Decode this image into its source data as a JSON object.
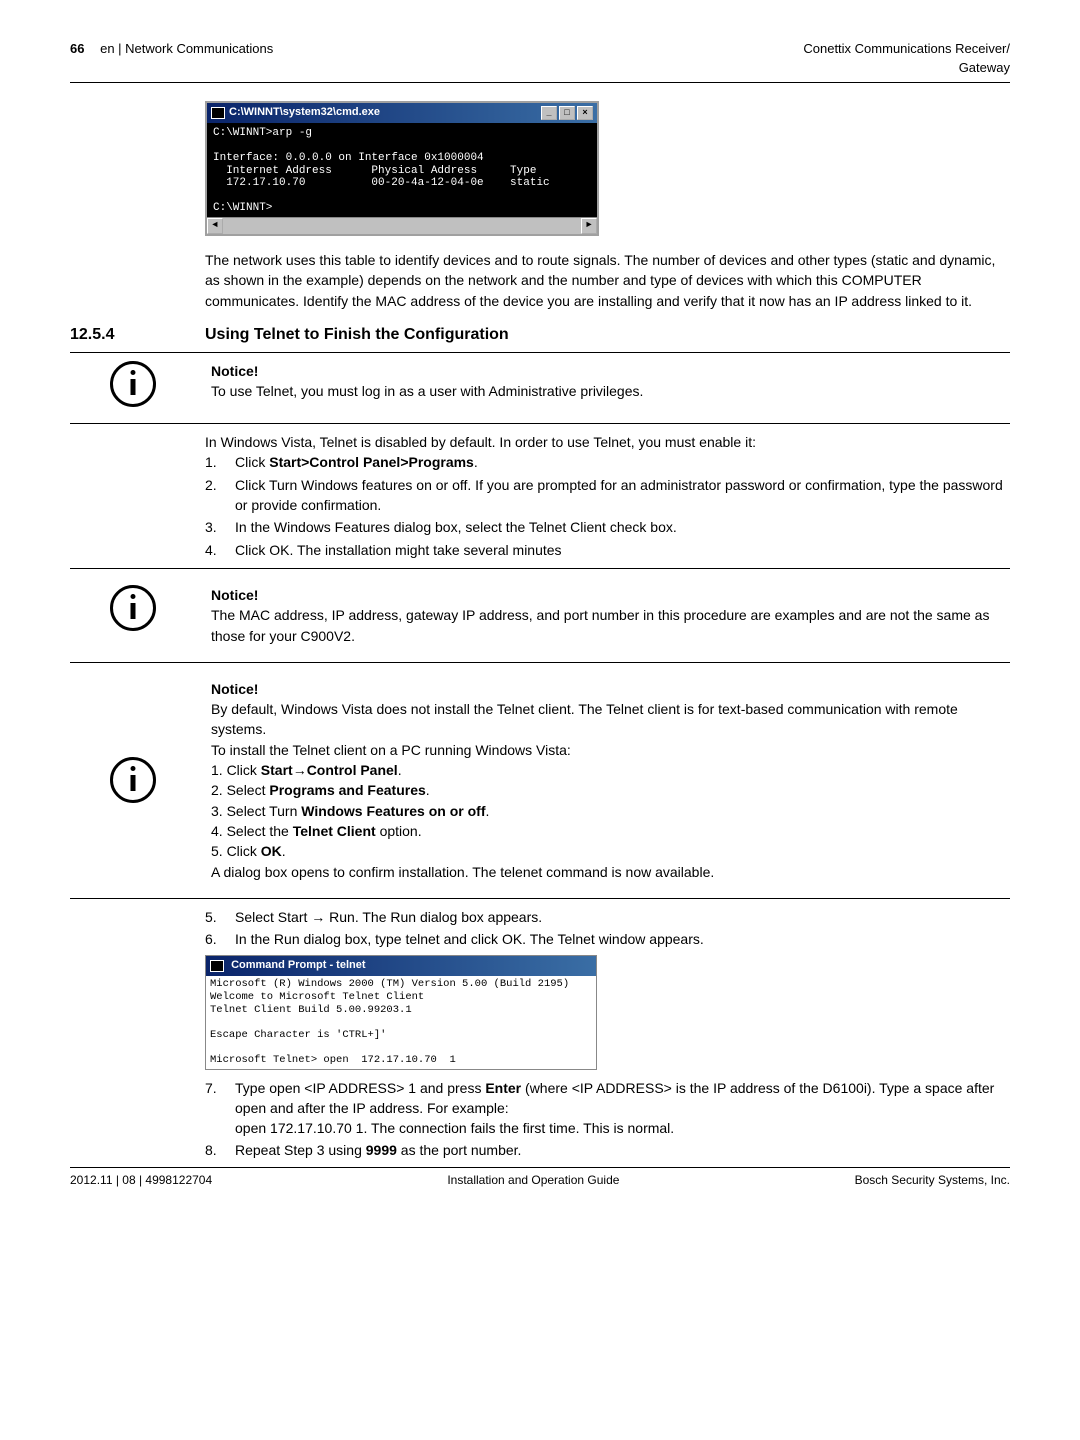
{
  "header": {
    "page_number": "66",
    "breadcrumb": "en | Network Communications",
    "product_line1": "Conettix Communications Receiver/",
    "product_line2": "Gateway"
  },
  "cmd_window": {
    "title": "C:\\WINNT\\system32\\cmd.exe",
    "lines": "C:\\WINNT>arp -g\n\nInterface: 0.0.0.0 on Interface 0x1000004\n  Internet Address      Physical Address     Type\n  172.17.10.70          00-20-4a-12-04-0e    static\n\nC:\\WINNT>"
  },
  "intro_paragraph": "The network uses this table to identify devices and to route signals. The number of devices and other types (static and dynamic, as shown in the example) depends on the network and the number and type of devices with which this COMPUTER communicates. Identify the MAC address of the device you are installing and verify that it now has an IP address linked to it.",
  "section": {
    "number": "12.5.4",
    "title": "Using Telnet to Finish the Configuration"
  },
  "notice1": {
    "title": "Notice!",
    "body": "To use Telnet, you must log in as a user with Administrative privileges."
  },
  "vista_intro": "In Windows Vista, Telnet is disabled by default. In order to use Telnet, you must enable it:",
  "vista_steps": [
    {
      "pre": "Click ",
      "bold": "Start>Control Panel>Programs",
      "post": "."
    },
    {
      "text": "Click Turn Windows features on or off. If you are prompted for an administrator password or confirmation, type the password or provide confirmation."
    },
    {
      "text": "In the Windows Features dialog box, select the Telnet Client check box."
    },
    {
      "text": "Click OK. The installation might take several minutes"
    }
  ],
  "notice2": {
    "title": "Notice!",
    "body": "The MAC address, IP address, gateway IP address, and port number in this procedure are examples and are not the same as those for your C900V2."
  },
  "notice3": {
    "title": "Notice!",
    "p1": "By default, Windows Vista does not install the Telnet client. The Telnet client is for text-based communication with remote systems.",
    "p2": "To install the Telnet client on a PC running Windows Vista:",
    "s1_pre": "1. Click ",
    "s1_bold": "Start→Control Panel",
    "s1_post": ".",
    "s2_pre": "2. Select ",
    "s2_bold": "Programs and Features",
    "s2_post": ".",
    "s3_pre": "3. Select Turn ",
    "s3_bold": "Windows Features on or off",
    "s3_post": ".",
    "s4_pre": "4. Select the ",
    "s4_bold": "Telnet Client",
    "s4_post": " option.",
    "s5_pre": "5. Click ",
    "s5_bold": "OK",
    "s5_post": ".",
    "p3": "A dialog box opens to confirm installation. The telenet command is now available."
  },
  "steps_after": [
    {
      "num": "5.",
      "text": "Select Start → Run. The Run dialog box appears."
    },
    {
      "num": "6.",
      "text": "In the Run dialog box, type telnet and click OK. The Telnet window appears."
    }
  ],
  "telnet_window": {
    "title": "Command Prompt - telnet",
    "body": "Microsoft (R) Windows 2000 (TM) Version 5.00 (Build 2195)\nWelcome to Microsoft Telnet Client\nTelnet Client Build 5.00.99203.1\n\nEscape Character is 'CTRL+]'\n\nMicrosoft Telnet> open  172.17.10.70  1"
  },
  "step7": {
    "num": "7.",
    "pre": "Type open <IP ADDRESS> 1 and press ",
    "bold": "Enter",
    "post": " (where <IP ADDRESS> is the IP address of the D6100i). Type a space after open and after the IP address. For example:",
    "line2": "open 172.17.10.70 1. The connection fails the first time. This is normal."
  },
  "step8": {
    "num": "8.",
    "pre": "Repeat Step 3 using ",
    "bold": "9999",
    "post": " as the port number."
  },
  "footer": {
    "left": "2012.11 | 08 | 4998122704",
    "center": "Installation and Operation Guide",
    "right": "Bosch Security Systems, Inc."
  }
}
